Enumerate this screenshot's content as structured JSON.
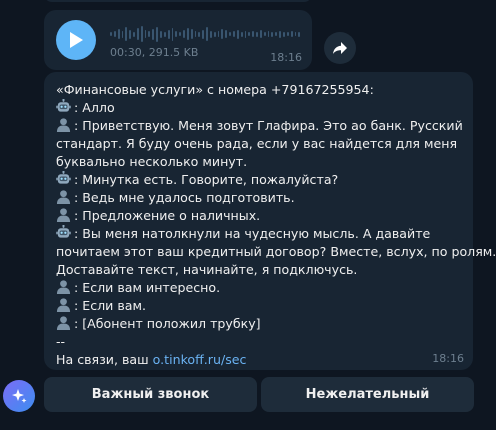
{
  "audio": {
    "meta": "00:30, 291.5 KB",
    "time": "18:16"
  },
  "message": {
    "lines": [
      {
        "icon": "",
        "text": "«Финансовые услуги» с номера +79167255954:"
      },
      {
        "icon": "robot-icon",
        "text": ": Алло"
      },
      {
        "icon": "person-icon",
        "text": ": Приветствую. Меня зовут Глафира. Это ао банк. Русский"
      },
      {
        "icon": "",
        "text": "стандарт. Я буду очень рада, если у вас найдется для меня"
      },
      {
        "icon": "",
        "text": "буквально несколько минут."
      },
      {
        "icon": "robot-icon",
        "text": ": Минутка есть. Говорите, пожалуйста?"
      },
      {
        "icon": "person-icon",
        "text": ": Ведь мне удалось подготовить."
      },
      {
        "icon": "person-icon",
        "text": ": Предложение о наличных."
      },
      {
        "icon": "robot-icon",
        "text": ": Вы меня натолкнули на чудесную мысль. А давайте"
      },
      {
        "icon": "",
        "text": "почитаем этот ваш кредитный договор? Вместе, вслух, по ролям."
      },
      {
        "icon": "",
        "text": "Доставайте текст, начинайте, я подключусь."
      },
      {
        "icon": "person-icon",
        "text": ": Если вам интересно."
      },
      {
        "icon": "person-icon",
        "text": ": Если вам."
      },
      {
        "icon": "person-icon",
        "text": ": [Абонент положил трубку]"
      },
      {
        "icon": "",
        "text": "--"
      }
    ],
    "footer_prefix": "На связи, ваш ",
    "footer_link": "o.tinkoff.ru/sec",
    "time": "18:16"
  },
  "keyboard": {
    "button1": "Важный звонок",
    "button2": "Нежелательный"
  },
  "colors": {
    "background": "#0e1621",
    "bubble": "#182533",
    "accent": "#5eb5f7",
    "link": "#6ab2f2"
  }
}
